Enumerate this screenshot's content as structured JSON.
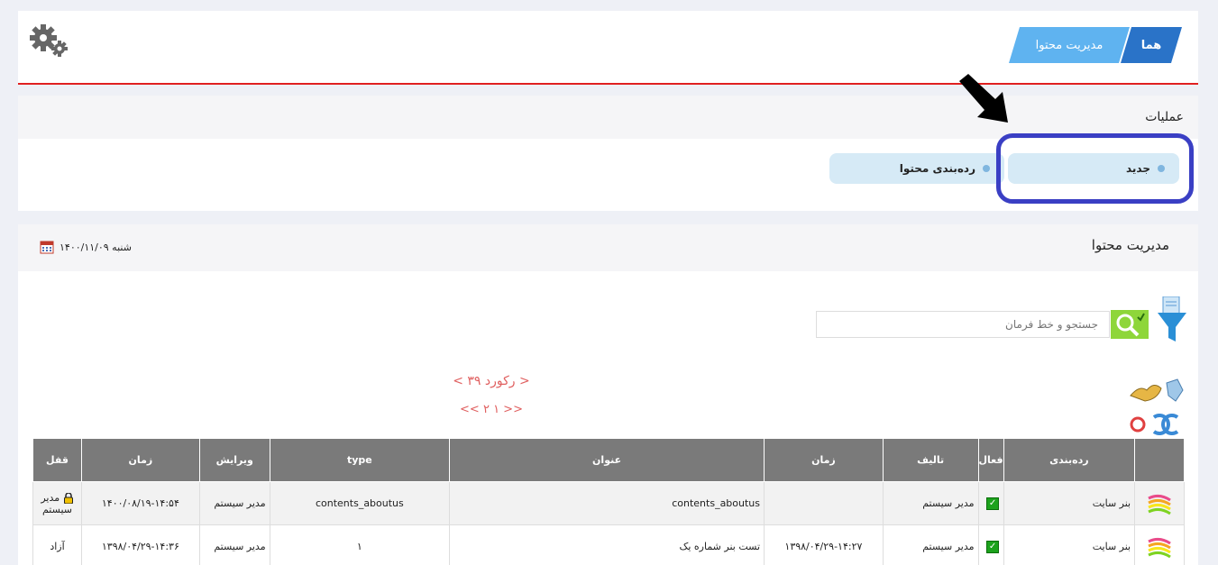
{
  "header": {
    "breadcrumb_home": "هما",
    "breadcrumb_current": "مدیریت محتوا"
  },
  "operations": {
    "title": "عملیات",
    "new_label": "جدید",
    "category_label": "رده‌بندی محتوا"
  },
  "content": {
    "title": "مدیریت محتوا",
    "date": "شنبه ۱۴۰۰/۱۱/۰۹",
    "search_placeholder": "جستجو و خط فرمان",
    "records": "< ۳۹ رکورد >",
    "pages": "<<  ۲ ۱  >>"
  },
  "table": {
    "headers": [
      "",
      "رده‌بندی",
      "فعال",
      "تالیف",
      "زمان",
      "عنوان",
      "type",
      "ویرایش",
      "زمان",
      "قفل"
    ],
    "rows": [
      {
        "category": "بنر سایت",
        "active": true,
        "author": "مدیر سیستم",
        "time": "",
        "title": "contents_aboutus",
        "type": "contents_aboutus",
        "editor": "مدیر سیستم",
        "edit_time": "۱۴۰۰/۰۸/۱۹-۱۴:۵۴",
        "lock": "مدیر سیستم",
        "locked": true
      },
      {
        "category": "بنر سایت",
        "active": true,
        "author": "مدیر سیستم",
        "time": "۱۳۹۸/۰۴/۲۹-۱۴:۲۷",
        "title": "تست بنر شماره یک",
        "type": "۱",
        "editor": "مدیر سیستم",
        "edit_time": "۱۳۹۸/۰۴/۲۹-۱۴:۳۶",
        "lock": "آزاد",
        "locked": false
      }
    ]
  },
  "colors": {
    "accent_red": "#e02020",
    "breadcrumb_dark": "#2a73c8",
    "breadcrumb_light": "#5fb3f0",
    "highlight": "#3a3fc4",
    "search_green": "#8ed63a"
  }
}
